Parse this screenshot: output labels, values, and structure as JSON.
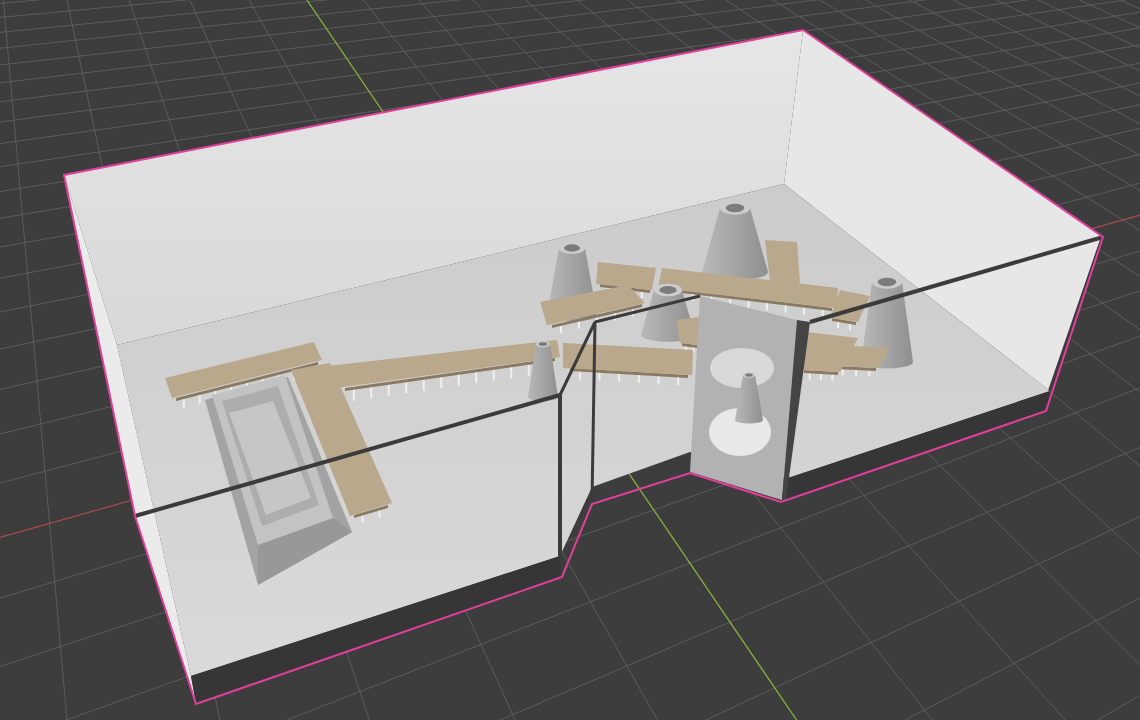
{
  "viewport": {
    "model": {
      "selected": true
    }
  }
}
